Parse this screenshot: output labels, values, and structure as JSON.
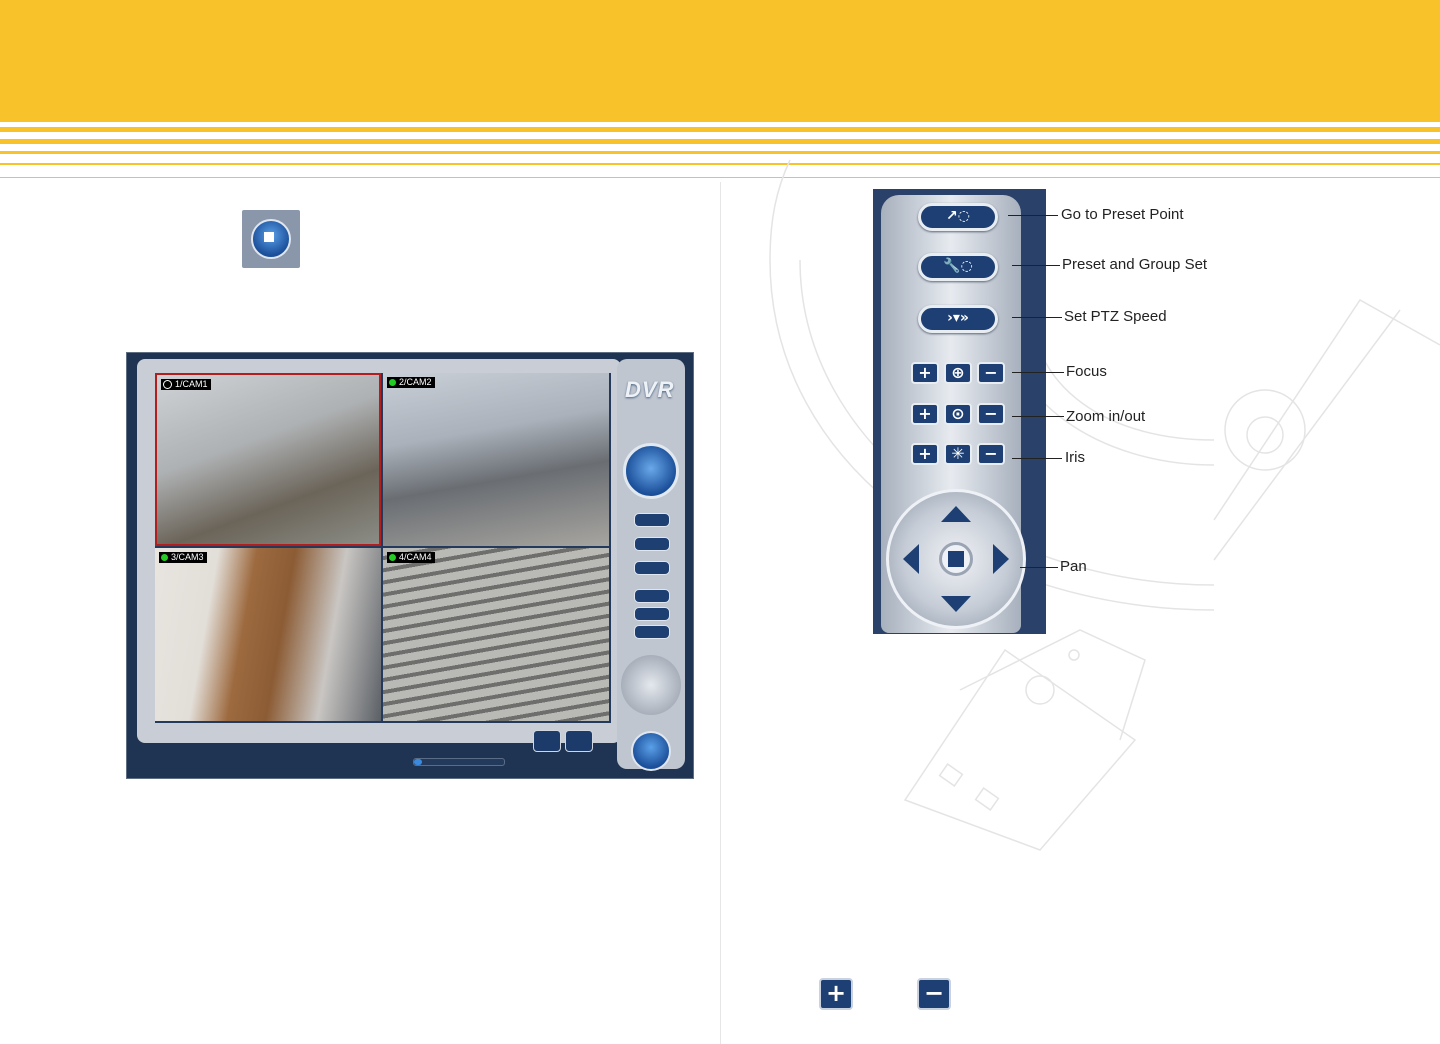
{
  "colors": {
    "banner": "#f8c22b",
    "panel_dark": "#1d3f73"
  },
  "dvr_window": {
    "logo": "DVR",
    "cameras": [
      {
        "label": "1/CAM1",
        "status_color": "#000000"
      },
      {
        "label": "2/CAM2",
        "status_color": "#22cc22"
      },
      {
        "label": "3/CAM3",
        "status_color": "#22cc22"
      },
      {
        "label": "4/CAM4",
        "status_color": "#22cc22"
      }
    ]
  },
  "ptz_panel": {
    "callouts": {
      "preset_point": "Go to Preset Point",
      "preset_group": "Preset and Group Set",
      "ptz_speed": "Set PTZ Speed",
      "focus": "Focus",
      "zoom": "Zoom in/out",
      "iris": "Iris",
      "pan": "Pan"
    },
    "plus_glyph": "+",
    "minus_glyph": "−"
  },
  "footer_icons": {
    "plus": "+",
    "minus": "−"
  },
  "icons": [
    "ptz-control-icon",
    "plus-icon",
    "minus-icon"
  ]
}
